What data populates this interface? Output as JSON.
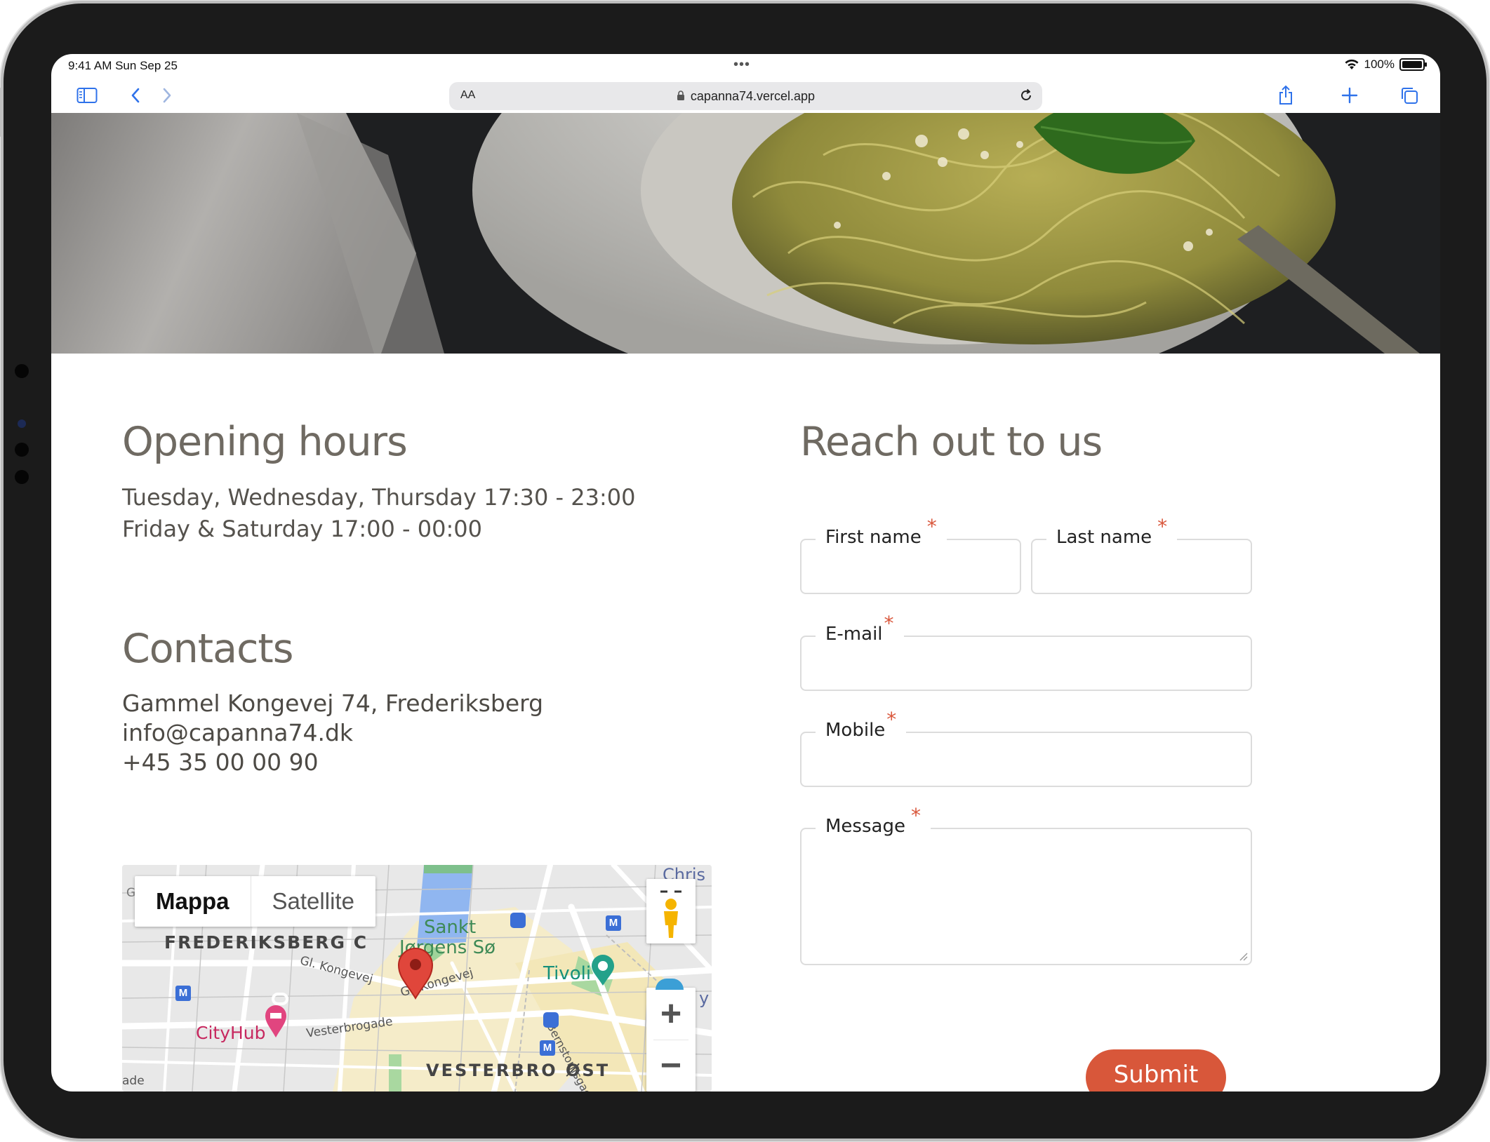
{
  "status_bar": {
    "time": "9:41 AM  Sun Sep 25",
    "dots": "•••",
    "battery": "100%"
  },
  "browser": {
    "text_size_label": "AA",
    "url": "capanna74.vercel.app"
  },
  "icons": {
    "sidebar": "sidebar-icon",
    "back": "chevron-left-icon",
    "forward": "chevron-right-icon",
    "lock": "lock-icon",
    "reload": "reload-icon",
    "share": "share-icon",
    "new_tab": "plus-icon",
    "tabs": "tabs-icon",
    "wifi": "wifi-icon",
    "battery": "battery-icon"
  },
  "opening_hours": {
    "heading": "Opening hours",
    "lines": [
      "Tuesday, Wednesday, Thursday 17:30 - 23:00",
      "Friday & Saturday 17:00 - 00:00"
    ]
  },
  "contacts": {
    "heading": "Contacts",
    "address": "Gammel Kongevej 74, Frederiksberg",
    "email": "info@capanna74.dk",
    "phone": "+45 35 00 00 90"
  },
  "map": {
    "type_map": "Mappa",
    "type_satellite": "Satellite",
    "labels": {
      "frederiksberg": "FREDERIKSBERG C",
      "sankt": "Sankt",
      "jorgens": "Jørgens Sø",
      "gl_kongevej_1": "Gl. Kongevej",
      "gl_kongevej_2": "Gl. Kongevej",
      "tivoli": "Tivoli",
      "cityhub": "CityHub",
      "vesterbrogade": "Vesterbrogade",
      "vesterbro_ost": "VESTERBRO ØST",
      "bernstorffsgade": "Bernstorffsgade",
      "chris": "Chris",
      "ade": "ade",
      "y": "y",
      "g": "G"
    },
    "metro": "M",
    "zoom_in": "+",
    "zoom_out": "−"
  },
  "form": {
    "heading": "Reach out to us",
    "required_mark": "*",
    "first_name": "First name",
    "last_name": "Last name",
    "email": "E-mail",
    "mobile": "Mobile",
    "message": "Message",
    "submit": "Submit"
  },
  "colors": {
    "accent": "#d8573a",
    "heading": "#6f6a62",
    "browser_blue": "#2f72ea"
  }
}
